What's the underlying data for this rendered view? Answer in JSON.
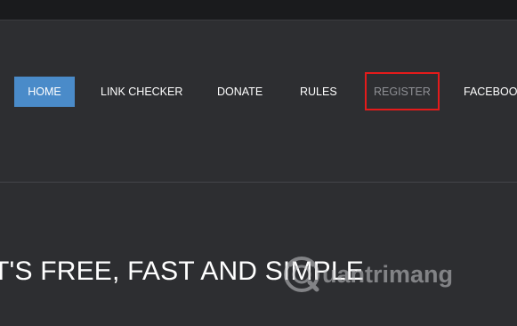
{
  "nav": {
    "items": [
      {
        "label": "HOME",
        "active": true
      },
      {
        "label": "LINK CHECKER"
      },
      {
        "label": "DONATE"
      },
      {
        "label": "RULES"
      },
      {
        "label": "REGISTER",
        "highlighted": true
      },
      {
        "label": "FACEBOOK"
      }
    ]
  },
  "hero": {
    "tagline": "T'S FREE, FAST AND SIMPLE"
  },
  "watermark": {
    "text_a": "uantrimang"
  },
  "colors": {
    "background": "#2d2e31",
    "topbar": "#1a1b1d",
    "active_tab": "#4a8bc9",
    "highlight_border": "#e41b1b",
    "dim_text": "#8f9095"
  }
}
